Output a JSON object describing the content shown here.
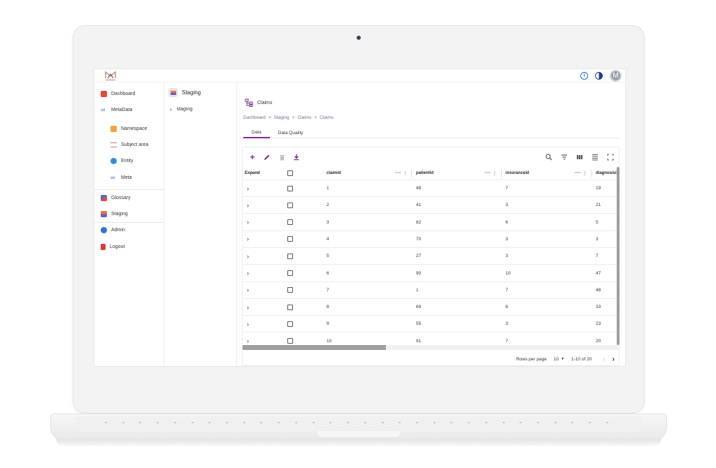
{
  "app": {
    "avatar_initial": "M",
    "accent": "#7a2a8e"
  },
  "nav": {
    "items": [
      {
        "label": "Dashboard",
        "icon": "dashboard-icon",
        "color": "#e8473b"
      },
      {
        "label": "MetaData",
        "icon": "meta-infinity-icon",
        "color": "#3b6fd9"
      },
      {
        "label": "Namespace",
        "icon": "namespace-icon",
        "color": "#f3a43b"
      },
      {
        "label": "Subject area",
        "icon": "subject-area-icon",
        "color": "#e96b8a"
      },
      {
        "label": "Entity",
        "icon": "entity-icon",
        "color": "#2e8fd8"
      },
      {
        "label": "Meta",
        "icon": "meta-infinity-icon",
        "color": "#3b6fd9"
      },
      {
        "label": "Glossary",
        "icon": "glossary-icon",
        "color": "#4b6fd1"
      },
      {
        "label": "Staging",
        "icon": "staging-icon",
        "color": "#e8733b"
      },
      {
        "label": "Admin",
        "icon": "admin-icon",
        "color": "#2f6fd8"
      },
      {
        "label": "Logout",
        "icon": "logout-icon",
        "color": "#e2383b"
      }
    ]
  },
  "mid": {
    "title": "Staging",
    "tree_item": "staging"
  },
  "main": {
    "title": "Claims",
    "breadcrumb": [
      "Dashboard",
      ">",
      "Staging",
      ">",
      "Claims",
      ">",
      "Claims"
    ],
    "tabs": [
      "Data",
      "Data Quality"
    ]
  },
  "table": {
    "columns": [
      "Expand",
      "claimid",
      "patientid",
      "insuranceid",
      "diagnosisi"
    ],
    "rows": [
      [
        "1",
        "48",
        "7",
        "19"
      ],
      [
        "2",
        "41",
        "3",
        "21"
      ],
      [
        "3",
        "82",
        "6",
        "5"
      ],
      [
        "4",
        "70",
        "3",
        "3"
      ],
      [
        "5",
        "27",
        "3",
        "7"
      ],
      [
        "6",
        "90",
        "10",
        "47"
      ],
      [
        "7",
        "1",
        "7",
        "48"
      ],
      [
        "8",
        "69",
        "6",
        "33"
      ],
      [
        "9",
        "55",
        "3",
        "23"
      ],
      [
        "10",
        "91",
        "7",
        "20"
      ]
    ],
    "footer": {
      "rows_per_page_label": "Rows per page",
      "rows_per_page": "10",
      "range": "1-10 of 20"
    }
  }
}
